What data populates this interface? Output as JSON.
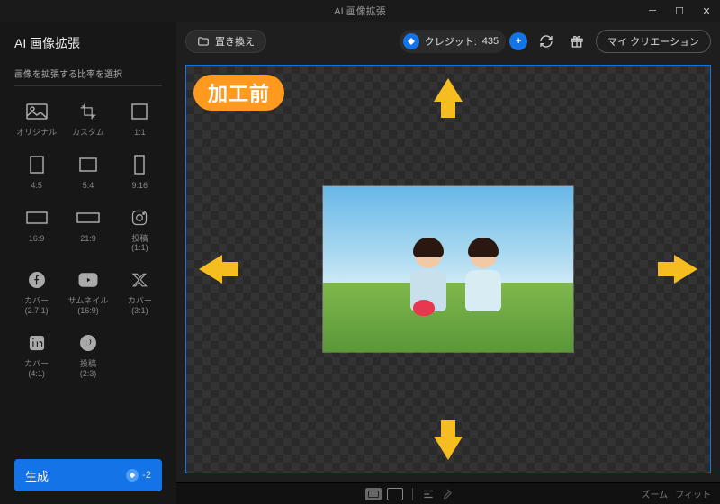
{
  "window": {
    "title": "AI 画像拡張"
  },
  "sidebar": {
    "title": "AI 画像拡張",
    "subtitle": "画像を拡張する比率を選択",
    "ratios": [
      {
        "label": "オリジナル",
        "icon": "image"
      },
      {
        "label": "カスタム",
        "icon": "crop"
      },
      {
        "label": "1:1",
        "icon": "square"
      },
      {
        "label": "4:5",
        "icon": "rect-v"
      },
      {
        "label": "5:4",
        "icon": "rect-h"
      },
      {
        "label": "9:16",
        "icon": "rect-tall"
      },
      {
        "label": "16:9",
        "icon": "rect-wide"
      },
      {
        "label": "21:9",
        "icon": "rect-uwide"
      },
      {
        "label": "投稿\n(1:1)",
        "icon": "instagram"
      },
      {
        "label": "カバー\n(2.7:1)",
        "icon": "facebook"
      },
      {
        "label": "サムネイル\n(16:9)",
        "icon": "youtube"
      },
      {
        "label": "カバー\n(3:1)",
        "icon": "x"
      },
      {
        "label": "カバー\n(4:1)",
        "icon": "linkedin"
      },
      {
        "label": "投稿\n(2:3)",
        "icon": "pinterest"
      }
    ],
    "generate": {
      "label": "生成",
      "cost": "-2"
    }
  },
  "topbar": {
    "replace": "置き換え",
    "credits_label": "クレジット:",
    "credits_value": "435",
    "my_creations": "マイ クリエーション"
  },
  "canvas": {
    "badge_before": "加工前"
  },
  "footer": {
    "zoom": "ズーム",
    "fit": "フィット"
  }
}
